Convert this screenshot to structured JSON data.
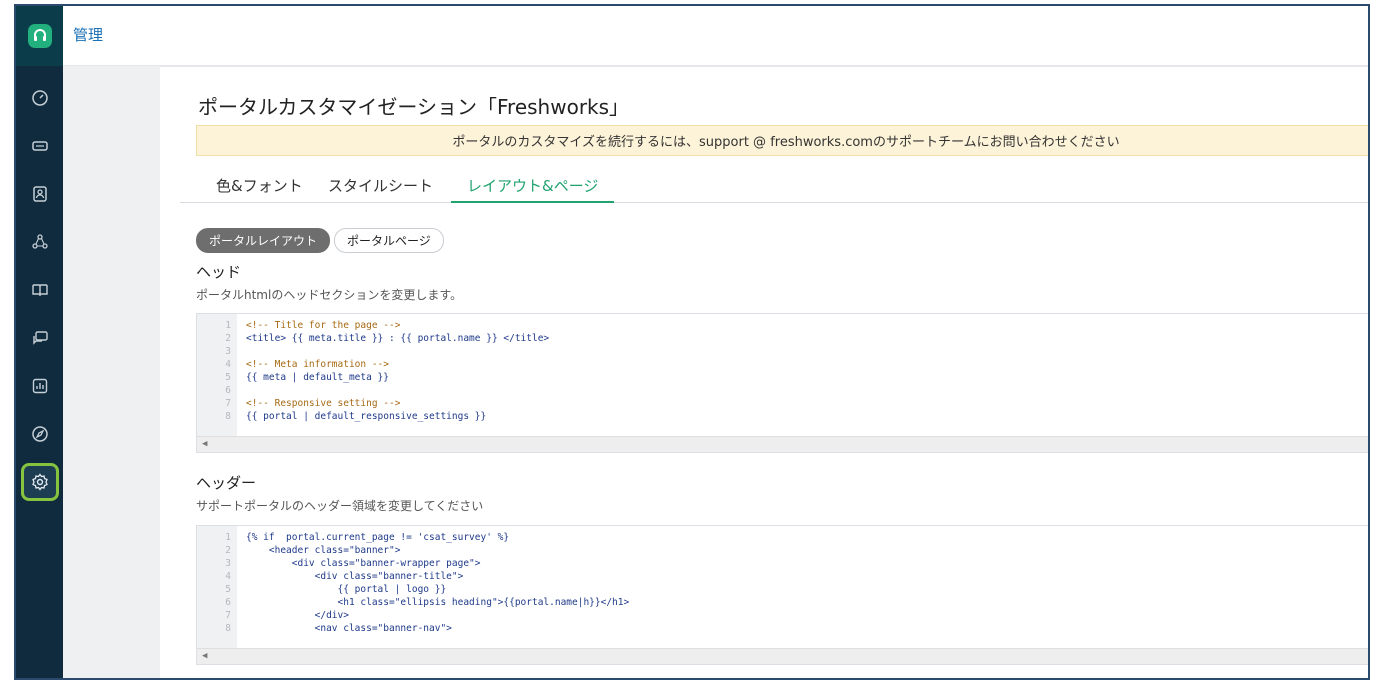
{
  "header": {
    "title": "管理"
  },
  "sidebar": {
    "items": [
      {
        "icon": "dashboard-icon"
      },
      {
        "icon": "tickets-icon"
      },
      {
        "icon": "contacts-icon"
      },
      {
        "icon": "groups-icon"
      },
      {
        "icon": "knowledge-base-icon"
      },
      {
        "icon": "forums-icon"
      },
      {
        "icon": "reports-icon"
      },
      {
        "icon": "discover-icon"
      },
      {
        "icon": "admin-gear-icon",
        "active": true
      }
    ]
  },
  "page": {
    "title": "ポータルカスタマイゼーション「Freshworks」",
    "notice": "ポータルのカスタマイズを続行するには、support @ freshworks.comのサポートチームにお問い合わせください",
    "tabs": [
      {
        "label": "色&フォント"
      },
      {
        "label": "スタイルシート"
      },
      {
        "label": "レイアウト&ページ",
        "active": true
      }
    ],
    "pills": [
      {
        "label": "ポータルレイアウト",
        "active": true
      },
      {
        "label": "ポータルページ"
      }
    ]
  },
  "sections": {
    "head": {
      "title": "ヘッド",
      "desc": "ポータルhtmlのヘッドセクションを変更します。",
      "lines": [
        {
          "n": "1",
          "t": "<!-- Title for the page -->",
          "k": "cm"
        },
        {
          "n": "2",
          "t": "<title> {{ meta.title }} : {{ portal.name }} </title>",
          "k": "tg"
        },
        {
          "n": "3",
          "t": "",
          "k": "tg"
        },
        {
          "n": "4",
          "t": "<!-- Meta information -->",
          "k": "cm"
        },
        {
          "n": "5",
          "t": "{{ meta | default_meta }}",
          "k": "tg"
        },
        {
          "n": "6",
          "t": "",
          "k": "tg"
        },
        {
          "n": "7",
          "t": "<!-- Responsive setting -->",
          "k": "cm"
        },
        {
          "n": "8",
          "t": "{{ portal | default_responsive_settings }}",
          "k": "tg"
        }
      ]
    },
    "header": {
      "title": "ヘッダー",
      "desc": "サポートポータルのヘッダー領域を変更してください",
      "lines": [
        {
          "n": "1",
          "t": "{% if  portal.current_page != 'csat_survey' %}",
          "k": "tg"
        },
        {
          "n": "2",
          "t": "    <header class=\"banner\">",
          "k": "tg"
        },
        {
          "n": "3",
          "t": "        <div class=\"banner-wrapper page\">",
          "k": "tg"
        },
        {
          "n": "4",
          "t": "            <div class=\"banner-title\">",
          "k": "tg"
        },
        {
          "n": "5",
          "t": "                {{ portal | logo }}",
          "k": "tg"
        },
        {
          "n": "6",
          "t": "                <h1 class=\"ellipsis heading\">{{portal.name|h}}</h1>",
          "k": "tg"
        },
        {
          "n": "7",
          "t": "            </div>",
          "k": "tg"
        },
        {
          "n": "8",
          "t": "            <nav class=\"banner-nav\">",
          "k": "tg"
        }
      ]
    }
  },
  "scroll": {
    "left_arrow": "◀"
  },
  "colors": {
    "accent": "#21a36f",
    "nav_bg": "#0f2b3d",
    "notice_bg": "#fdf3d8",
    "active_ring": "#86c440"
  }
}
